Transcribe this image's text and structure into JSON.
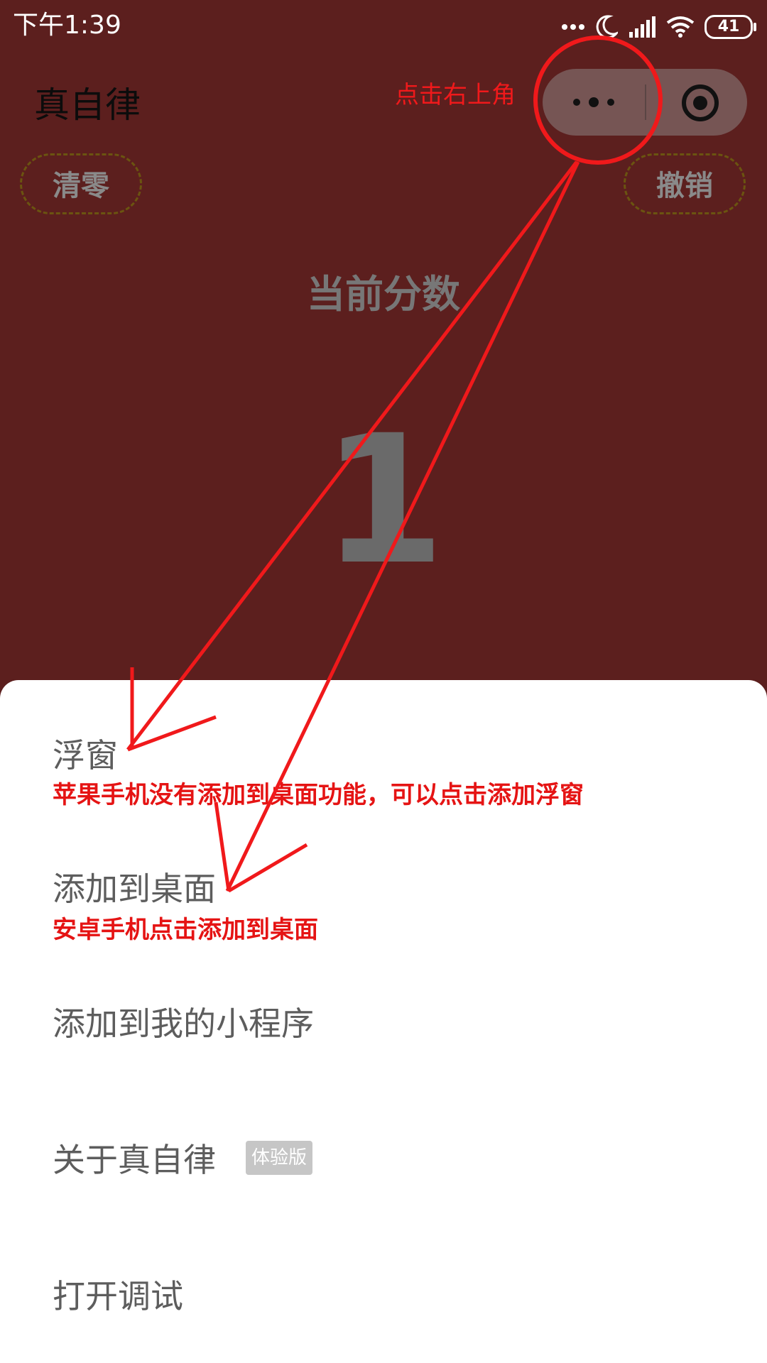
{
  "status_bar": {
    "time": "下午1:39",
    "battery": "41"
  },
  "header": {
    "title": "真自律"
  },
  "buttons": {
    "clear": "清零",
    "undo": "撤销"
  },
  "score": {
    "label": "当前分数",
    "value": "1"
  },
  "menu": {
    "float": "浮窗",
    "add_desktop": "添加到桌面",
    "add_mini": "添加到我的小程序",
    "about": "关于真自律",
    "about_badge": "体验版",
    "debug": "打开调试"
  },
  "annotations": {
    "top_hint": "点击右上角",
    "apple_note": "苹果手机没有添加到桌面功能，可以点击添加浮窗",
    "android_note": "安卓手机点击添加到桌面"
  },
  "colors": {
    "background": "#5c1f1e",
    "annotation": "#f0191b",
    "sheet": "#ffffff"
  }
}
